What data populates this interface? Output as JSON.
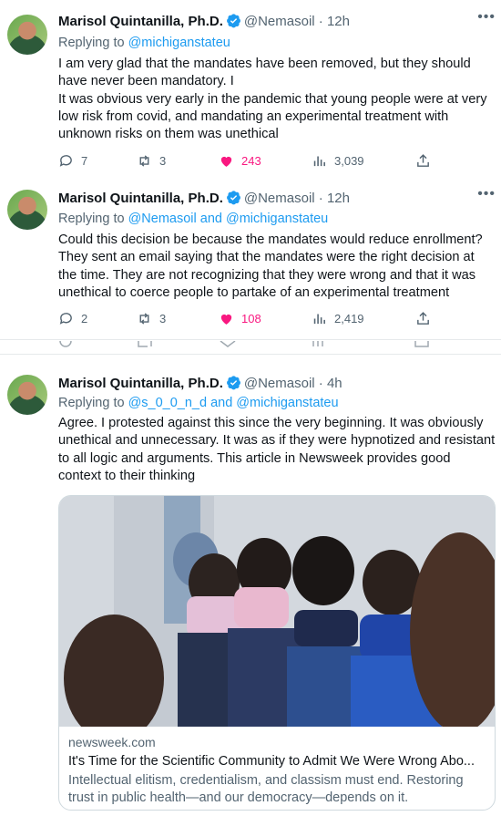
{
  "tweets": [
    {
      "name": "Marisol Quintanilla, Ph.D.",
      "handle": "@Nemasoil",
      "time": "12h",
      "reply_prefix": "Replying to",
      "reply_to": "@michiganstateu",
      "text_1": "I am very glad that the mandates have been removed, but they should have never been mandatory.  I",
      "text_2": "It was obvious very early in the pandemic that young people were at very low risk from covid, and mandating an experimental treatment with unknown risks on them was unethical",
      "replies": "7",
      "retweets": "3",
      "likes": "243",
      "views": "3,039"
    },
    {
      "name": "Marisol Quintanilla, Ph.D.",
      "handle": "@Nemasoil",
      "time": "12h",
      "reply_prefix": "Replying to",
      "reply_to": "@Nemasoil and @michiganstateu",
      "text_1": "Could this decision be because the mandates would reduce enrollment? They sent an email saying that the mandates were the right decision at the time.  They are not recognizing that they were wrong and that it was unethical to coerce people to partake of an experimental treatment",
      "replies": "2",
      "retweets": "3",
      "likes": "108",
      "views": "2,419"
    },
    {
      "name": "Marisol Quintanilla, Ph.D.",
      "handle": "@Nemasoil",
      "time": "4h",
      "reply_prefix": "Replying to",
      "reply_to": "@s_0_0_n_d and @michiganstateu",
      "text_1": "Agree. I protested against this since the very beginning. It was obviously unethical and unnecessary.  It was as if they were hypnotized  and resistant to all logic and arguments. This article in Newsweek provides good context to their thinking"
    }
  ],
  "card": {
    "domain": "newsweek.com",
    "title": "It's Time for the Scientific Community to Admit We Were Wrong Abo...",
    "description": "Intellectual elitism, credentialism, and classism must end. Restoring trust in public health—and our democracy—depends on it."
  },
  "colors": {
    "accent": "#1d9bf0",
    "like": "#f91880",
    "muted": "#536471"
  },
  "icons": [
    "verified-icon",
    "more-icon",
    "reply-icon",
    "retweet-icon",
    "heart-icon",
    "views-icon",
    "share-icon"
  ]
}
